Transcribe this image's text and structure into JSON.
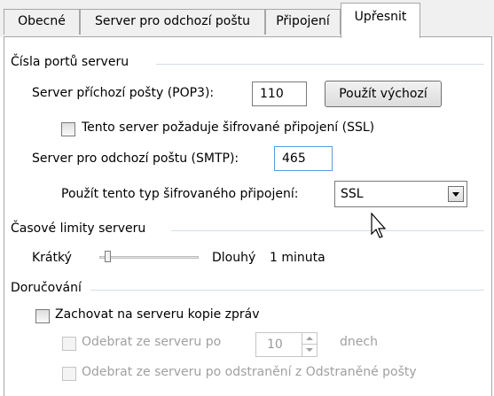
{
  "tabs": [
    {
      "label": "Obecné"
    },
    {
      "label": "Server pro odchozí poštu"
    },
    {
      "label": "Připojení"
    },
    {
      "label": "Upřesnit"
    }
  ],
  "ports_group": {
    "title": "Čísla portů serveru",
    "pop3_label": "Server příchozí pošty (POP3):",
    "pop3_value": "110",
    "default_button": "Použít výchozí",
    "ssl_checkbox_label": "Tento server požaduje šifrované připojení (SSL)",
    "smtp_label": "Server pro odchozí poštu (SMTP):",
    "smtp_value": "465",
    "encryption_label": "Použít tento typ šifrovaného připojení:",
    "encryption_value": "SSL"
  },
  "timeouts_group": {
    "title": "Časové limity serveru",
    "short_label": "Krátký",
    "long_label": "Dlouhý",
    "timeout_value": "1 minuta"
  },
  "delivery_group": {
    "title": "Doručování",
    "keep_copy_label": "Zachovat na serveru kopie zpráv",
    "remove_after_label": "Odebrat ze serveru po",
    "days_value": "10",
    "days_unit": "dnech",
    "remove_deleted_label": "Odebrat ze serveru po odstranění z Odstraněné pošty"
  }
}
